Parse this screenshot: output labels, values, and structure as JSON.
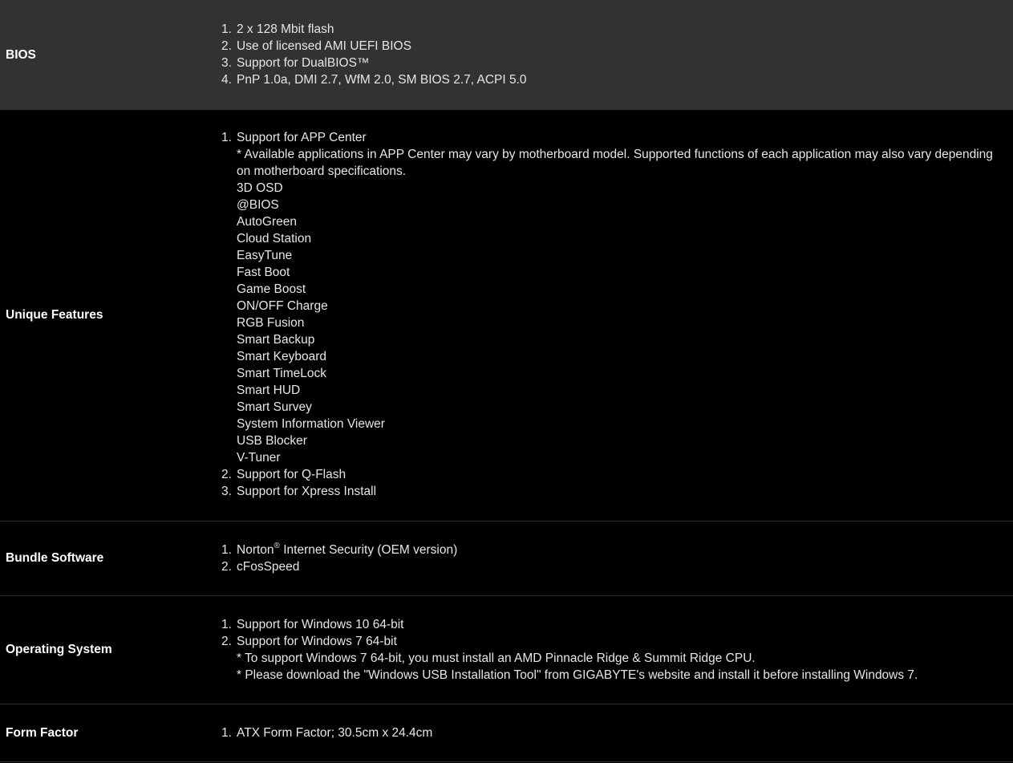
{
  "colors": {
    "background": "#000000",
    "highlight_row": "#323232",
    "text": "#e6e6e6",
    "label": "#ffffff",
    "divider": "#2e2e2e"
  },
  "bios": {
    "label": "BIOS",
    "items": [
      {
        "num": "1.",
        "text": "2 x 128 Mbit flash"
      },
      {
        "num": "2.",
        "text": "Use of licensed AMI UEFI BIOS"
      },
      {
        "num": "3.",
        "text": "Support for DualBIOS™"
      },
      {
        "num": "4.",
        "text": "PnP 1.0a, DMI 2.7, WfM 2.0, SM BIOS 2.7, ACPI 5.0"
      }
    ]
  },
  "unique_features": {
    "label": "Unique Features",
    "item1": {
      "num": "1.",
      "text": "Support for APP Center",
      "note_line1": "* Available applications in APP Center may vary by motherboard model. Supported functions of each application may also vary depending",
      "note_line2": "on motherboard specifications.",
      "apps": [
        "3D OSD",
        "@BIOS",
        "AutoGreen",
        "Cloud Station",
        "EasyTune",
        "Fast Boot",
        "Game Boost",
        "ON/OFF Charge",
        "RGB Fusion",
        "Smart Backup",
        "Smart Keyboard",
        "Smart TimeLock",
        "Smart HUD",
        "Smart Survey",
        "System Information Viewer",
        "USB Blocker",
        "V-Tuner"
      ]
    },
    "item2": {
      "num": "2.",
      "text": "Support for Q-Flash"
    },
    "item3": {
      "num": "3.",
      "text": "Support for Xpress Install"
    }
  },
  "bundle_software": {
    "label": "Bundle Software",
    "item1": {
      "num": "1.",
      "text_before": "Norton",
      "sup": "®",
      "text_after": " Internet Security (OEM version)"
    },
    "item2": {
      "num": "2.",
      "text": "cFosSpeed"
    }
  },
  "operating_system": {
    "label": "Operating System",
    "item1": {
      "num": "1.",
      "text": "Support for Windows 10 64-bit"
    },
    "item2": {
      "num": "2.",
      "text": "Support for Windows 7 64-bit",
      "note1": "* To support Windows 7 64-bit, you must install an AMD Pinnacle Ridge & Summit Ridge CPU.",
      "note2": "* Please download the \"Windows USB Installation Tool\" from GIGABYTE's website and install it before installing Windows 7."
    }
  },
  "form_factor": {
    "label": "Form Factor",
    "item1": {
      "num": "1.",
      "text": "ATX Form Factor; 30.5cm x 24.4cm"
    }
  }
}
